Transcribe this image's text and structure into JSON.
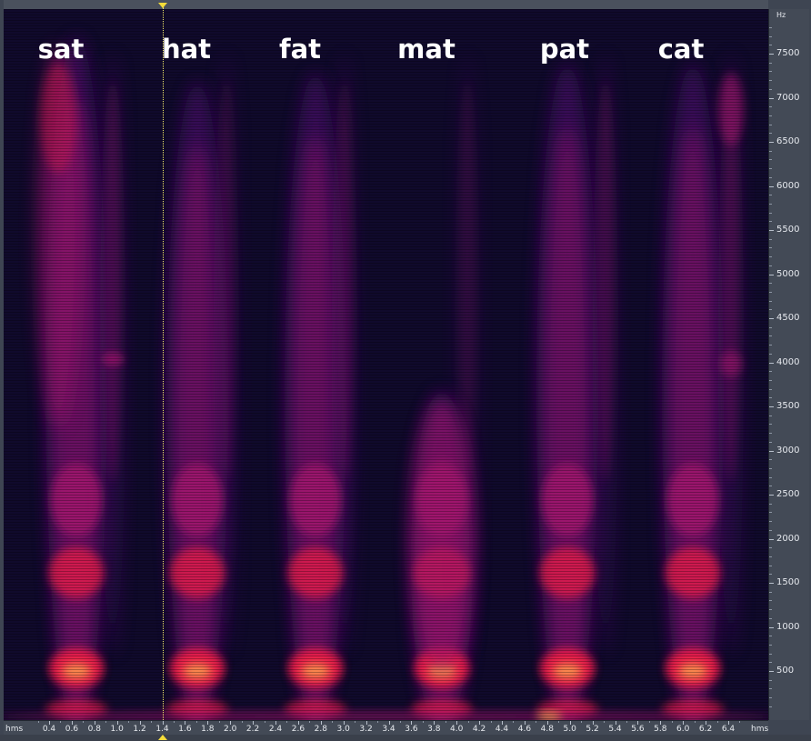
{
  "spectrogram": {
    "words": [
      "sat",
      "hat",
      "fat",
      "mat",
      "pat",
      "cat"
    ],
    "colors": {
      "background": "#100a2c",
      "low_energy": "#3b0e5a",
      "mid_energy": "#a3166e",
      "high_energy": "#f01a4a",
      "peak": "#ffb050",
      "playhead": "#f3e96a"
    }
  },
  "frequency_axis": {
    "unit": "Hz",
    "ticks": [
      "7500",
      "7000",
      "6500",
      "6000",
      "5500",
      "5000",
      "4500",
      "4000",
      "3500",
      "3000",
      "2500",
      "2000",
      "1500",
      "1000",
      "500"
    ]
  },
  "time_axis": {
    "unit_left": "hms",
    "unit_right": "hms",
    "ticks": [
      "0.4",
      "0.6",
      "0.8",
      "1.0",
      "1.2",
      "1.4",
      "1.6",
      "1.8",
      "2.0",
      "2.2",
      "2.4",
      "2.6",
      "2.8",
      "3.0",
      "3.2",
      "3.4",
      "3.6",
      "3.8",
      "4.0",
      "4.2",
      "4.4",
      "4.6",
      "4.8",
      "5.0",
      "5.2",
      "5.4",
      "5.6",
      "5.8",
      "6.0",
      "6.2",
      "6.4"
    ]
  },
  "playhead": {
    "time": "1.4"
  }
}
